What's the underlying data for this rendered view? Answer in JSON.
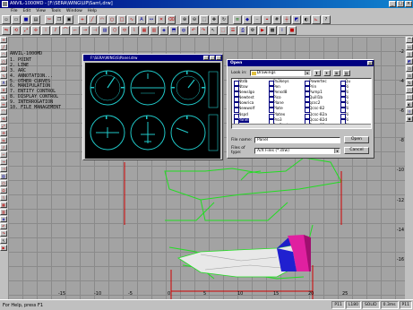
{
  "window": {
    "title": "ANVIL-1000MD - [F:\\SERA\\WING\\UP\\Sam\\.drw]"
  },
  "menu": [
    "File",
    "Edit",
    "View",
    "Tools",
    "Window",
    "Help"
  ],
  "screen_menu": {
    "header": "ANVIL-1000MD",
    "items": [
      "1. POINT",
      "2. LINE",
      "3. ARC",
      "4. ANNOTATION...",
      "5. OTHER CURVES",
      "6. MANIPULATION",
      "7. ENTITY CONTROL",
      "8. DISPLAY CONTROL",
      "9. INTERROGATION",
      "10. FILE MANAGEMENT"
    ]
  },
  "viewer": {
    "title": "F:\\SERA\\WING\\S\\Panel.drw"
  },
  "open_dialog": {
    "title": "Open",
    "look_in_label": "Look in:",
    "look_in_value": "Drawings",
    "files": [
      [
        "Ntdb",
        "Ntsw",
        "Newslgo",
        "Newtest",
        "Nowrica",
        "Newwolf",
        "Nspd",
        "Panel"
      ],
      [
        "Pa3keys",
        "Pen",
        "Pensd8",
        "Pico",
        "Plane",
        "Plate",
        "Platex",
        "Pro3",
        "Pro5twk"
      ],
      [
        "Powertec",
        "Prin",
        "Pump1",
        "Quill1b",
        "qcsc2",
        "Qcsc-82",
        "Qcsc-82a",
        "Qcsc-82d",
        "Qcsc-83a"
      ],
      [
        "Qu",
        "Ri",
        "Ri",
        "Ri",
        "Ri",
        "Ri",
        "Ri",
        "Ri",
        "Ri"
      ]
    ],
    "selected_file": "Panel",
    "file_name_label": "File name:",
    "file_name_value": "Panel",
    "files_of_type_label": "Files of type:",
    "files_of_type_value": "A/X Files (*.drw)",
    "open_button": "Open",
    "cancel_button": "Cancel"
  },
  "axes": {
    "y_labels": [
      "-2",
      "-4",
      "-6",
      "-8",
      "-10",
      "-12",
      "-14",
      "-16"
    ],
    "x_labels": [
      "-15",
      "-10",
      "-5",
      "0",
      "5",
      "10",
      "15",
      "20",
      "25"
    ]
  },
  "status": {
    "text": "For Help, press F1",
    "fields": [
      "P11",
      "L180",
      "SOLID",
      "0.3ms",
      "P11"
    ]
  },
  "colors": {
    "title_blue": "#000080",
    "drawing_green": "#22dd22",
    "drawing_red": "#d00000",
    "tail_blue": "#2020d0",
    "tail_magenta": "#e020a0",
    "gauge_cyan": "#20c8c8"
  }
}
